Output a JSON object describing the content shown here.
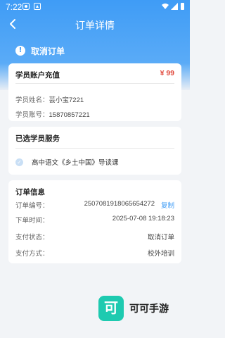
{
  "status_bar": {
    "time": "7:22",
    "icons": [
      "app-notification-icon",
      "app-notification-icon-2",
      "wifi-icon",
      "signal-icon",
      "battery-icon"
    ]
  },
  "nav": {
    "title": "订单详情",
    "back_icon": "chevron-left-icon"
  },
  "order_status": {
    "icon": "alert-icon",
    "text": "取消订单"
  },
  "account_card": {
    "title": "学员账户充值",
    "price": "¥ 99",
    "student_name_label": "学员姓名：",
    "student_name": "芸小宝7221",
    "student_account_label": "学员账号：",
    "student_account": "15870857221"
  },
  "service_card": {
    "title": "已选学员服务",
    "item": "高中语文《乡土中国》导读课"
  },
  "order_info": {
    "title": "订单信息",
    "rows": [
      {
        "label": "订单编号：",
        "value": "2507081918065654272",
        "action": "复制"
      },
      {
        "label": "下单时间：",
        "value": "2025-07-08 19:18:23"
      },
      {
        "label": "支付状态：",
        "value": "取消订单"
      },
      {
        "label": "支付方式：",
        "value": "校外培训"
      }
    ]
  },
  "brand": {
    "logo_char": "可",
    "name": "可可手游"
  },
  "colors": {
    "primary": "#3f9cf6",
    "price": "#e0483b",
    "brand": "#1ecab0"
  }
}
